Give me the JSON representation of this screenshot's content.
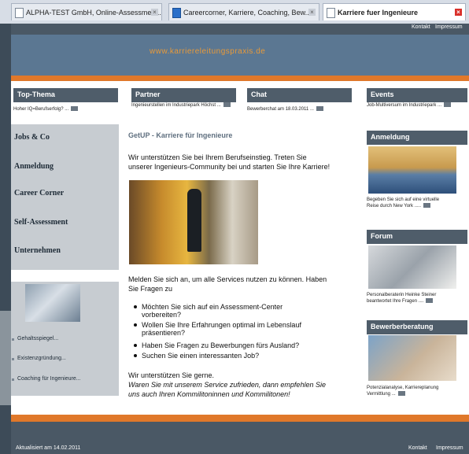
{
  "browser": {
    "tabs": [
      {
        "label": "ALPHA-TEST GmbH, Online-Assessment...",
        "active": false
      },
      {
        "label": "Careercorner, Karriere, Coaching, Bew...",
        "active": false
      },
      {
        "label": "Karriere fuer Ingenieure",
        "active": true
      }
    ]
  },
  "header": {
    "links": [
      "Kontakt",
      "Impressum"
    ],
    "banner_url": "www.karriereleitungspraxis.de"
  },
  "top_sections": {
    "top_thema": {
      "title": "Top-Thema",
      "teaser": "Hoher IQ=Berufserfolg? ..."
    },
    "partner": {
      "title": "Partner",
      "teaser": "Ingenieurstellen im Industriepark Höchst ..."
    },
    "chat": {
      "title": "Chat",
      "teaser": "Bewerberchat am 18.03.2011 ..."
    },
    "events": {
      "title": "Events",
      "teaser": "Job-Multiversum im Industriepark ..."
    }
  },
  "left_nav": {
    "items": [
      "Jobs & Co",
      "Anmeldung",
      "Career Corner",
      "Self-Assessment",
      "Unternehmen"
    ]
  },
  "left_links": [
    "Gehaltsspiegel...",
    "Existenzgründung...",
    "Coaching für Ingenieure..."
  ],
  "main": {
    "title": "GetUP - Karriere für Ingenieure",
    "intro_line1": "Wir unterstützen Sie bei Ihrem Berufseinstieg. Treten Sie",
    "intro_line2": "unserer Ingenieurs-Community bei und starten Sie Ihre Karriere!",
    "signup_line1": "Melden Sie sich an, um alle Services nutzen zu können. Haben",
    "signup_line2": "Sie Fragen zu",
    "bullets": [
      {
        "l1": "Möchten Sie sich auf ein Assessment-Center",
        "l2": "vorbereiten?"
      },
      {
        "l1": "Wollen Sie Ihre Erfahrungen optimal im Lebenslauf",
        "l2": "präsentieren?"
      },
      {
        "l1": "Haben Sie Fragen zu Bewerbungen fürs Ausland?",
        "l2": ""
      },
      {
        "l1": "Suchen Sie einen interessanten Job?",
        "l2": ""
      }
    ],
    "closing1": "Wir unterstützen Sie gerne.",
    "closing2": "Waren Sie mit unserem Service zufrieden, dann empfehlen Sie",
    "closing3": "uns auch Ihren Kommilitoninnen und Kommilitonen!"
  },
  "right": {
    "anmeldung": {
      "title": "Anmeldung",
      "l1": "Begeben Sie sich auf eine virtuelle",
      "l2": "Reise durch New York ....."
    },
    "forum": {
      "title": "Forum",
      "l1": "Personalberaterin Heinke Steiner",
      "l2": "beantwortet Ihre Fragen ...."
    },
    "bewerberberatung": {
      "title": "Bewerberberatung",
      "l1": "Potenzialanalyse, Karriereplanung",
      "l2": "Vermittlung ..."
    }
  },
  "footer": {
    "updated": "Aktualisiert am 14.02.2011",
    "links": [
      "Kontakt",
      "Impressum"
    ]
  },
  "colors": {
    "accent": "#e0782a",
    "bar": "#4f5d6a",
    "banner": "#5b7792",
    "nav_bg": "#c7ccd1"
  }
}
